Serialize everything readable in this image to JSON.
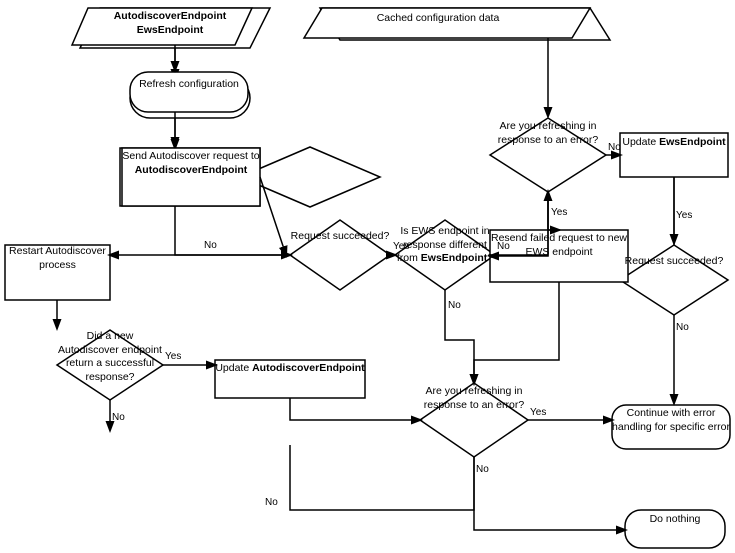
{
  "nodes": {
    "startParallel": {
      "label": "AutodiscoverEndpoint\nEwsEndpoint",
      "type": "parallelogram"
    },
    "cachedData": {
      "label": "Cached configuration data",
      "type": "parallelogram-right"
    },
    "refreshConfig": {
      "label": "Refresh configuration",
      "type": "rounded-rect"
    },
    "sendAutodiscover": {
      "label": "Send Autodiscover request to AutodiscoverEndpoint",
      "type": "rect"
    },
    "requestSucceeded1": {
      "label": "Request succeeded?",
      "type": "diamond"
    },
    "isEwsDifferent": {
      "label": "Is EWS endpoint in response different from EwsEndpoint?",
      "type": "diamond"
    },
    "restartAutodiscover": {
      "label": "Restart Autodiscover process",
      "type": "rect"
    },
    "didNewEndpoint": {
      "label": "Did a new Autodiscover endpoint return a successful response?",
      "type": "diamond"
    },
    "updateAutodiscoverEndpoint": {
      "label": "Update AutodiscoverEndpoint",
      "type": "rect"
    },
    "refreshingError1": {
      "label": "Are you refreshing in response to an error?",
      "type": "diamond"
    },
    "updateEwsEndpoint": {
      "label": "Update EwsEndpoint",
      "type": "rect"
    },
    "requestSucceeded2": {
      "label": "Request succeeded?",
      "type": "diamond"
    },
    "resendFailed": {
      "label": "Resend failed request to new EWS endpoint",
      "type": "rect"
    },
    "refreshingError2": {
      "label": "Are you refreshing in response to an error?",
      "type": "diamond"
    },
    "continueError": {
      "label": "Continue with error handling for specific error",
      "type": "rounded-rect"
    },
    "doNothing": {
      "label": "Do nothing",
      "type": "rounded-rect"
    }
  },
  "labels": {
    "yes": "Yes",
    "no": "No"
  },
  "colors": {
    "black": "#000",
    "white": "#fff",
    "gray": "#888"
  }
}
